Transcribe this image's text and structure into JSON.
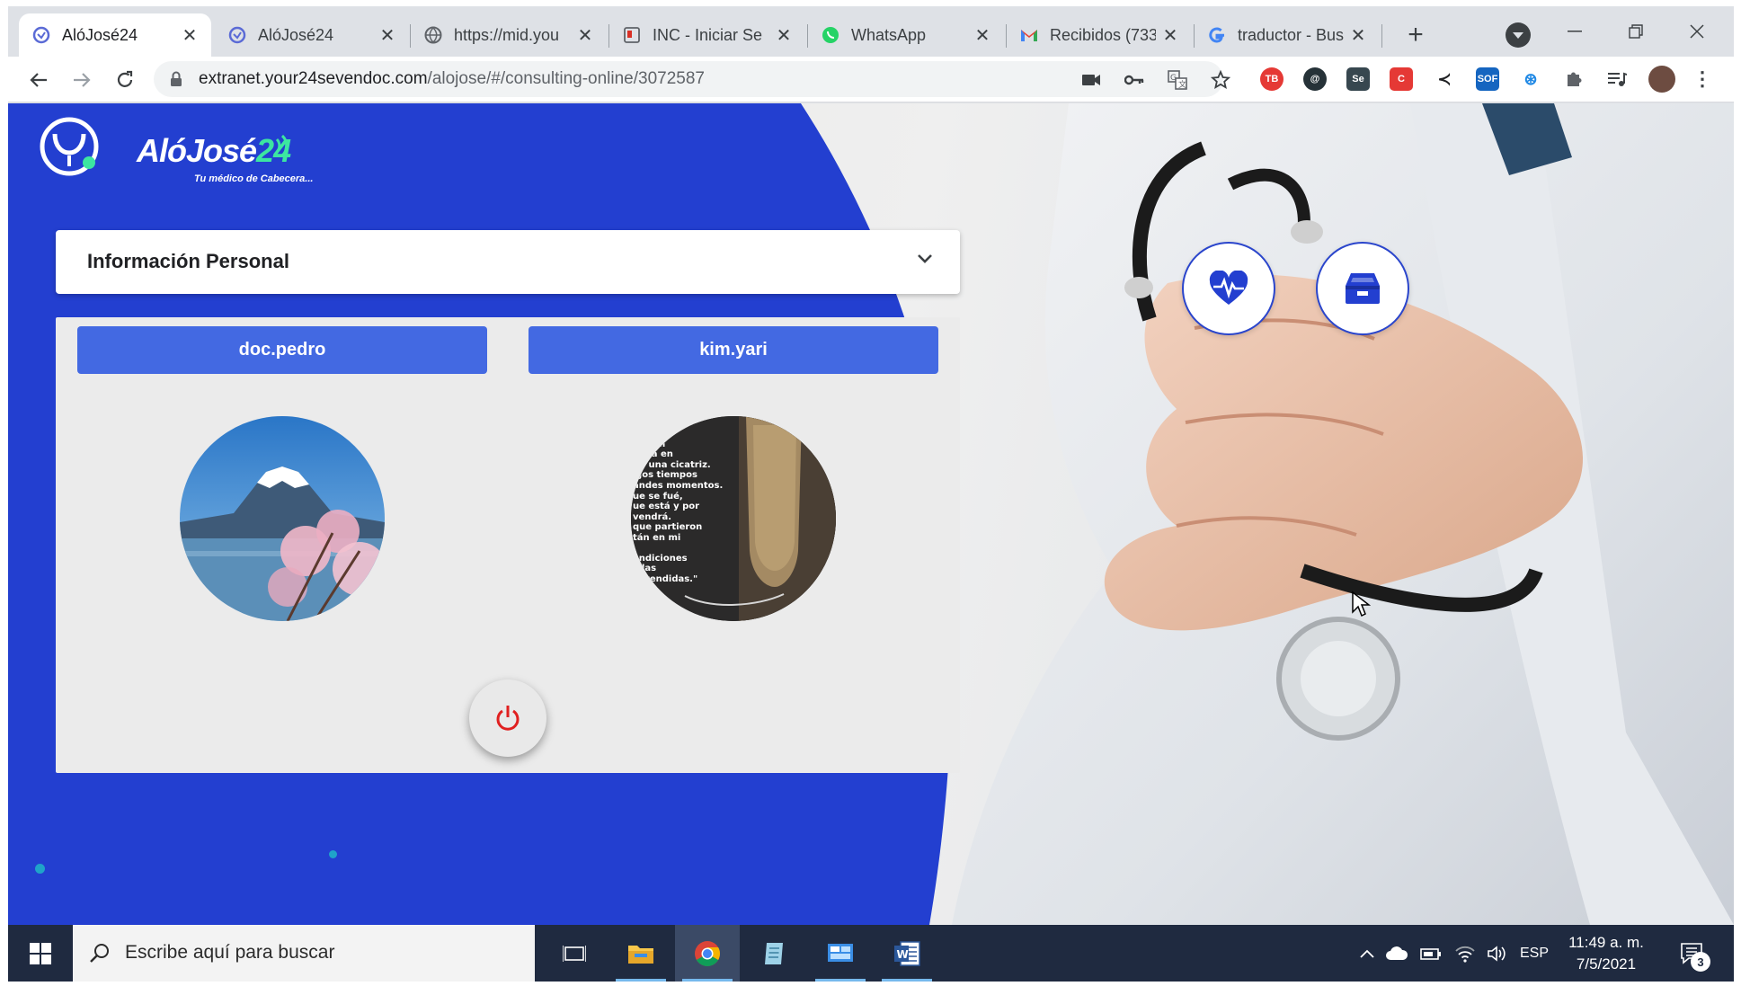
{
  "browser": {
    "tabs": [
      {
        "title": "AlóJosé24",
        "favicon": "alojose-icon",
        "active": true
      },
      {
        "title": "AlóJosé24",
        "favicon": "alojose-icon",
        "active": false
      },
      {
        "title": "https://mid.you",
        "favicon": "globe-icon",
        "active": false
      },
      {
        "title": "INC - Iniciar Se",
        "favicon": "page-icon",
        "active": false
      },
      {
        "title": "WhatsApp",
        "favicon": "whatsapp-icon",
        "active": false
      },
      {
        "title": "Recibidos (733",
        "favicon": "gmail-icon",
        "active": false
      },
      {
        "title": "traductor - Bus",
        "favicon": "google-icon",
        "active": false
      }
    ],
    "url_host": "extranet.your24sevendoc.com",
    "url_path": "/alojose/#/consulting-online/3072587"
  },
  "page": {
    "logo_text": "AlóJosé",
    "logo_num": "24",
    "logo_tagline": "Tu médico de Cabecera...",
    "info_title": "Información Personal",
    "users": [
      {
        "name": "doc.pedro"
      },
      {
        "name": "kim.yari"
      }
    ],
    "quote_lines": [
      "eré.",
      "pieron",
      "uella en",
      "no una cicatriz.",
      "ejos tiempos",
      "andes momentos.",
      "ue se fué,",
      "ue está y por",
      "vendrá.",
      "que partieron",
      "tán en mi",
      "",
      "endiciones",
      "y las",
      "aprendidas.\""
    ],
    "colors": {
      "primary_blue": "#233fd0",
      "button_blue": "#4369e2",
      "accent_green": "#3ce6a1",
      "power_red": "#e02020"
    }
  },
  "taskbar": {
    "search_placeholder": "Escribe aquí para buscar",
    "language": "ESP",
    "time": "11:49 a. m.",
    "date": "7/5/2021",
    "notifications": "3"
  }
}
